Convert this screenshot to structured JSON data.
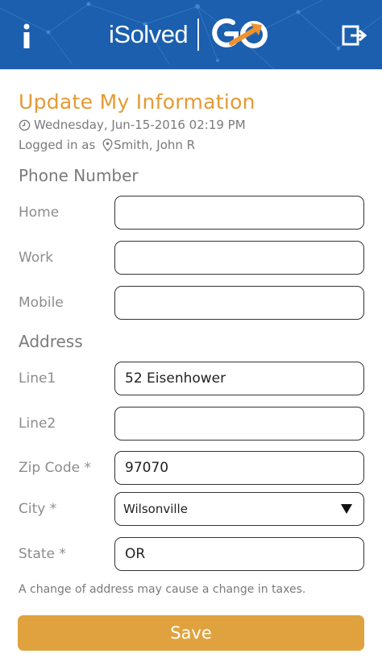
{
  "header": {
    "info_icon": "info-icon",
    "logo_text": "iSolved",
    "logo_badge": "GO",
    "logout_icon": "logout-icon",
    "background_color": "#1b5fae"
  },
  "page": {
    "title": "Update My Information",
    "timestamp": "Wednesday, Jun-15-2016 02:19 PM",
    "logged_in_prefix": "Logged in as ",
    "logged_in_user": "Smith, John R",
    "accent_color": "#e59a32"
  },
  "phone": {
    "section_label": "Phone Number",
    "home_label": "Home",
    "home_value": "",
    "work_label": "Work",
    "work_value": "",
    "mobile_label": "Mobile",
    "mobile_value": ""
  },
  "address": {
    "section_label": "Address",
    "line1_label": "Line1",
    "line1_value": "52 Eisenhower",
    "line2_label": "Line2",
    "line2_value": "",
    "zip_label": "Zip Code *",
    "zip_value": "97070",
    "city_label": "City *",
    "city_value": "Wilsonville",
    "state_label": "State *",
    "state_value": "OR"
  },
  "notice": "A change of address may cause a change in taxes.",
  "save_label": "Save",
  "save_color": "#e0a23e"
}
